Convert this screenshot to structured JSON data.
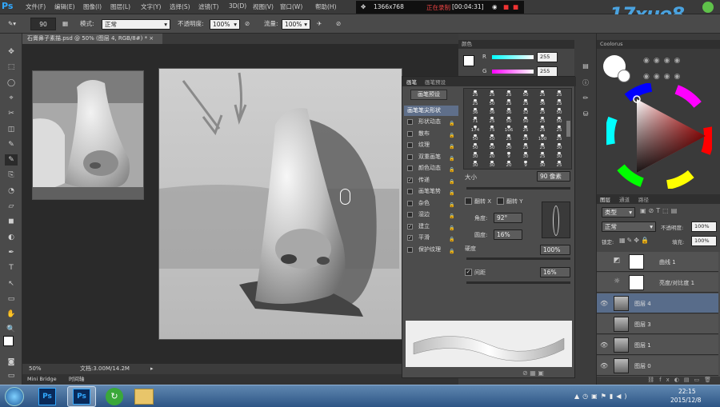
{
  "menubar": {
    "logo": "Ps",
    "items": [
      "文件(F)",
      "编辑(E)",
      "图像(I)",
      "图层(L)",
      "文字(Y)",
      "选择(S)",
      "滤镜(T)",
      "3D(D)",
      "视图(V)",
      "窗口(W)",
      "帮助(H)"
    ]
  },
  "recorder": {
    "resolution": "1366x768",
    "status": "正在录制",
    "time": "[00:04:31]"
  },
  "watermark": "17xue8",
  "options": {
    "size": "90",
    "mode_label": "模式:",
    "mode_value": "正常",
    "opacity_label": "不透明度:",
    "opacity_value": "100%",
    "flow_label": "流量:",
    "flow_value": "100%"
  },
  "document": {
    "tab_title": "石膏鼻子素描.psd @ 50% (图层 4, RGB/8#) *",
    "zoom": "50%",
    "doc_size": "文档:3.00M/14.2M"
  },
  "minibridge": {
    "tab1": "Mini Bridge",
    "tab2": "时间轴"
  },
  "color_panel": {
    "tab": "颜色",
    "r_value": "255",
    "g_value": "255"
  },
  "brush_panel": {
    "tab1": "画笔",
    "tab2": "画笔预设",
    "preset_button": "画笔预设",
    "tip_shape_header": "画笔笔尖形状",
    "options": [
      {
        "label": "形状动态",
        "checked": false
      },
      {
        "label": "散布",
        "checked": false
      },
      {
        "label": "纹理",
        "checked": false
      },
      {
        "label": "双重画笔",
        "checked": false
      },
      {
        "label": "颜色动态",
        "checked": false
      },
      {
        "label": "传递",
        "checked": true
      },
      {
        "label": "画笔笔势",
        "checked": false
      },
      {
        "label": "杂色",
        "checked": false
      },
      {
        "label": "湿边",
        "checked": false
      },
      {
        "label": "建立",
        "checked": true
      },
      {
        "label": "平滑",
        "checked": true
      },
      {
        "label": "保护纹理",
        "checked": false
      }
    ],
    "tip_sizes": [
      "25",
      "25",
      "25",
      "50",
      "25",
      "25",
      "25",
      "50",
      "25",
      "25",
      "36",
      "25",
      "36",
      "36",
      "36",
      "32",
      "25",
      "50",
      "71",
      "25",
      "50",
      "50",
      "25",
      "50",
      "174",
      "75",
      "106",
      "25",
      "25",
      "25",
      "50",
      "50",
      "25",
      "25",
      "100",
      "25",
      "50",
      "50",
      "50",
      "25",
      "25",
      "30",
      "30",
      "20",
      "9",
      "30",
      "25",
      "30",
      "30",
      "30",
      "20",
      "9",
      "30",
      "25"
    ],
    "size_label": "大小",
    "size_value": "90 像素",
    "flip_x": "翻转 X",
    "flip_y": "翻转 Y",
    "angle_label": "角度:",
    "angle_value": "92°",
    "roundness_label": "圆度:",
    "roundness_value": "16%",
    "hardness_label": "硬度",
    "spacing_label": "间距",
    "spacing_value": "16%",
    "spacing_checked": true,
    "top_value": "100%"
  },
  "coolorus": {
    "tab": "Coolorus"
  },
  "layers_panel": {
    "tab1": "图层",
    "tab2": "通道",
    "tab3": "路径",
    "filter": "类型",
    "blend_mode": "正常",
    "opacity_label": "不透明度:",
    "opacity_value": "100%",
    "lock_label": "锁定:",
    "fill_label": "填充:",
    "fill_value": "100%",
    "layers": [
      {
        "name": "曲线 1",
        "visible": false,
        "selected": false
      },
      {
        "name": "亮度/对比度 1",
        "visible": false,
        "selected": false
      },
      {
        "name": "图层 4",
        "visible": true,
        "selected": true
      },
      {
        "name": "图层 3",
        "visible": false,
        "selected": false
      },
      {
        "name": "图层 1",
        "visible": true,
        "selected": false
      },
      {
        "name": "图层 0",
        "visible": true,
        "selected": false
      }
    ]
  },
  "taskbar": {
    "time": "22:15",
    "date": "2015/12/8"
  },
  "colors": {
    "accent": "#31a8ff",
    "selected_layer": "#586c8a"
  }
}
